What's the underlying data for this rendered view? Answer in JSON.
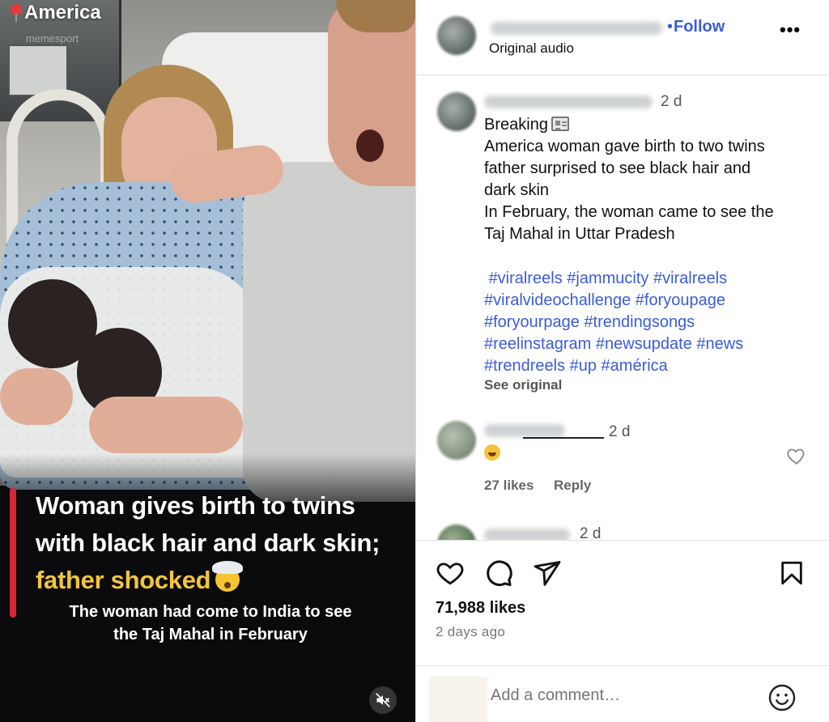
{
  "video": {
    "location_label": "America",
    "watermark": "memesport",
    "headline": {
      "line1": "Woman gives birth to twins",
      "line2": "with black hair and dark skin;",
      "line3": "father shocked"
    },
    "subtitle": {
      "line1": "The woman had come to India to see",
      "line2": "the Taj Mahal in February"
    },
    "mute_icon": "speaker-muted-icon",
    "accent_colors": {
      "red_bar": "#d72638",
      "headline_yellow": "#f3c53b"
    }
  },
  "post_header": {
    "follow_label": "Follow",
    "dot": "•",
    "audio_label": "Original audio",
    "more_label": "•••"
  },
  "caption": {
    "time": "2 d",
    "lines": [
      "Breaking",
      "America woman gave birth to two twins",
      "father surprised to see black hair and",
      "dark skin",
      "In February, the woman came to see the",
      "Taj Mahal in Uttar Pradesh"
    ],
    "hashtag_lines": [
      " #viralreels #jammucity #viralreels",
      "#viralvideochallenge #foryoupage",
      "#foryourpage #trendingsongs",
      "#reelinstagram #newsupdate #news",
      "#trendreels #up #américa"
    ],
    "see_original": "See original"
  },
  "comments": [
    {
      "time": "2 d",
      "likes": "27 likes",
      "reply": "Reply"
    },
    {
      "time": "2 d"
    }
  ],
  "actions": {
    "like_icon": "heart-icon",
    "comment_icon": "comment-bubble-icon",
    "share_icon": "paper-plane-icon",
    "save_icon": "bookmark-icon",
    "likes": "71,988 likes",
    "posted": "2 days ago"
  },
  "add_comment": {
    "placeholder": "Add a comment…",
    "emoji_icon": "smiley-icon"
  },
  "colors": {
    "link_blue": "#3b5cdb",
    "divider": "#dbdbdb"
  }
}
